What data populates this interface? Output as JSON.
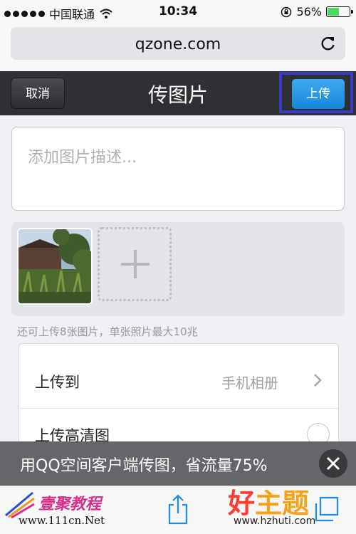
{
  "status_bar": {
    "carrier": "中国联通",
    "time": "10:34",
    "battery_percent": "56%",
    "battery_level": 0.56,
    "battery_color": "#4cd964"
  },
  "browser": {
    "url": "qzone.com",
    "reload_icon": "reload-icon"
  },
  "header": {
    "cancel_label": "取消",
    "title": "传图片",
    "upload_label": "上传",
    "upload_color": "#1e8fe0"
  },
  "description": {
    "placeholder": "添加图片描述..."
  },
  "photos": {
    "add_icon": "plus-icon"
  },
  "hint": "还可上传8张图片，单张照片最大10兆",
  "settings": {
    "upload_to_label": "上传到",
    "upload_to_value": "手机相册",
    "hd_label": "上传高清图"
  },
  "banner": {
    "text": "用QQ空间客户端传图，省流量75%",
    "close_icon": "close-icon"
  },
  "toolbar": {
    "share_icon": "share-icon",
    "tabs_icon": "tabs-icon"
  },
  "watermarks": {
    "left_logo": "壹聚教程",
    "left_url": "www.111cn.Net",
    "right_logo_1": "好",
    "right_logo_2": "主题",
    "right_url": "www.hzhuti.com"
  }
}
